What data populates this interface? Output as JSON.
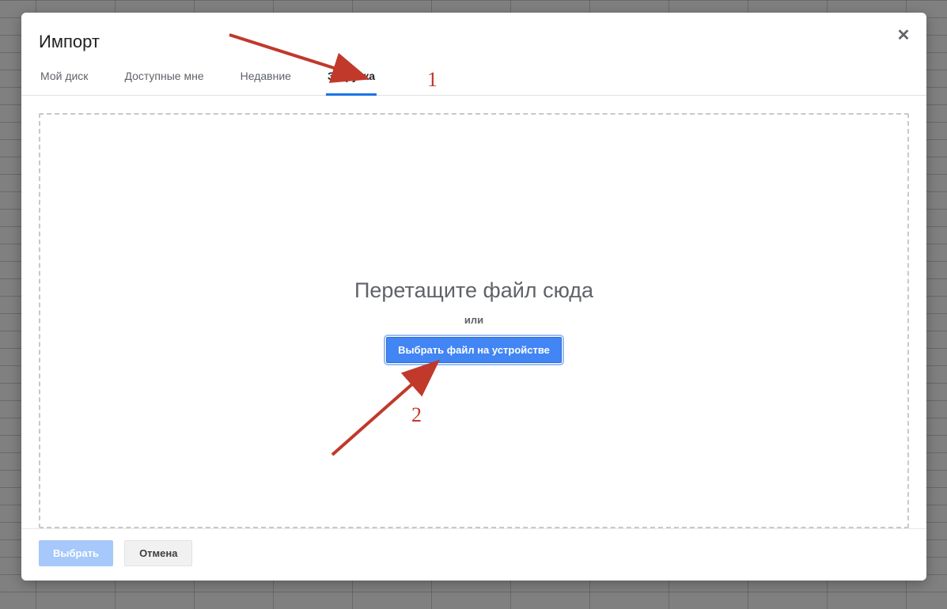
{
  "dialog": {
    "title": "Импорт",
    "close_glyph": "✕"
  },
  "tabs": [
    {
      "label": "Мой диск",
      "active": false
    },
    {
      "label": "Доступные мне",
      "active": false
    },
    {
      "label": "Недавние",
      "active": false
    },
    {
      "label": "Загрузка",
      "active": true
    }
  ],
  "dropzone": {
    "title": "Перетащите файл сюда",
    "or": "или",
    "pick_button": "Выбрать файл на устройстве"
  },
  "footer": {
    "select": "Выбрать",
    "cancel": "Отмена"
  },
  "annotations": {
    "n1": "1",
    "n2": "2"
  }
}
